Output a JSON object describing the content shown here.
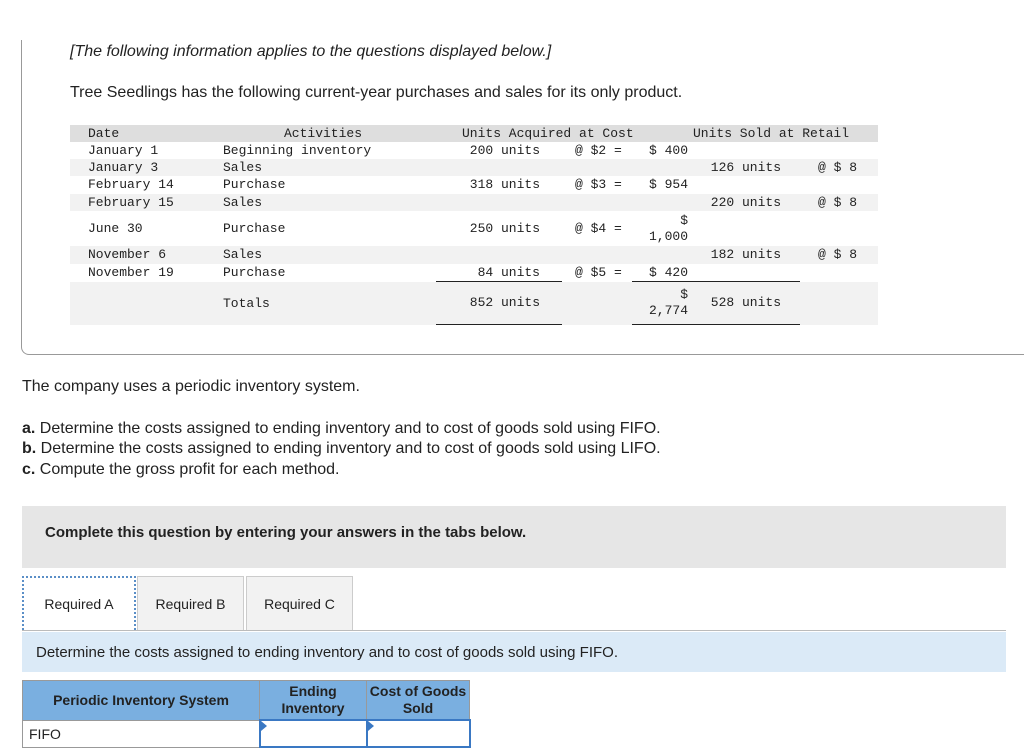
{
  "intro": {
    "bracket_note": "[The following information applies to the questions displayed below.]",
    "description": "Tree Seedlings has the following current-year purchases and sales for its only product."
  },
  "inventory_table": {
    "headers": {
      "date": "Date",
      "activities": "Activities",
      "acquired": "Units Acquired at Cost",
      "sold": "Units Sold at Retail"
    },
    "rows": [
      {
        "date": "January 1",
        "activity": "Beginning inventory",
        "units": "200 units",
        "rate": "@ $2 =",
        "cost": "$ 400",
        "sold": "",
        "sold_rate": ""
      },
      {
        "date": "January 3",
        "activity": "Sales",
        "units": "",
        "rate": "",
        "cost": "",
        "sold": "126 units",
        "sold_rate": "@ $ 8"
      },
      {
        "date": "February 14",
        "activity": "Purchase",
        "units": "318 units",
        "rate": "@ $3 =",
        "cost": "$ 954",
        "sold": "",
        "sold_rate": ""
      },
      {
        "date": "February 15",
        "activity": "Sales",
        "units": "",
        "rate": "",
        "cost": "",
        "sold": "220 units",
        "sold_rate": "@ $ 8"
      },
      {
        "date": "June 30",
        "activity": "Purchase",
        "units": "250 units",
        "rate": "@ $4 =",
        "cost_symbol": "$",
        "cost": "1,000",
        "sold": "",
        "sold_rate": ""
      },
      {
        "date": "November 6",
        "activity": "Sales",
        "units": "",
        "rate": "",
        "cost": "",
        "sold": "182 units",
        "sold_rate": "@ $ 8"
      },
      {
        "date": "November 19",
        "activity": "Purchase",
        "units": "84 units",
        "rate": "@ $5 =",
        "cost": "$ 420",
        "sold": "",
        "sold_rate": ""
      }
    ],
    "totals": {
      "label": "Totals",
      "units": "852 units",
      "cost_symbol": "$",
      "cost": "2,774",
      "sold": "528 units"
    }
  },
  "questions": {
    "system": "The company uses a periodic inventory system.",
    "a_label": "a.",
    "a": " Determine the costs assigned to ending inventory and to cost of goods sold using FIFO.",
    "b_label": "b.",
    "b": " Determine the costs assigned to ending inventory and to cost of goods sold using LIFO.",
    "c_label": "c.",
    "c": " Compute the gross profit for each method."
  },
  "complete_banner": "Complete this question by entering your answers in the tabs below.",
  "tabs": [
    {
      "label": "Required A",
      "active": true
    },
    {
      "label": "Required B",
      "active": false
    },
    {
      "label": "Required C",
      "active": false
    }
  ],
  "instruction": "Determine the costs assigned to ending inventory and to cost of goods sold using FIFO.",
  "answer_table": {
    "headers": [
      "Periodic Inventory System",
      "Ending Inventory",
      "Cost of Goods Sold"
    ],
    "rows": [
      {
        "label": "FIFO",
        "ending_inventory": "",
        "cogs": ""
      }
    ]
  },
  "colors": {
    "header_blue": "#7aafe0",
    "instruction_bg": "#dbeaf7",
    "input_border": "#3a78c3"
  }
}
